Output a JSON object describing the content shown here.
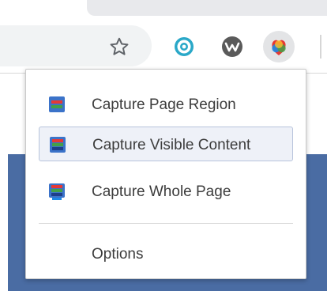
{
  "toolbar": {
    "bookmark_icon": "star-icon",
    "extensions": [
      {
        "name": "extension-clock-icon",
        "color": "#2aa8c8"
      },
      {
        "name": "extension-w-icon",
        "color": "#5a5a5a"
      },
      {
        "name": "extension-screenshot-icon",
        "color": "#e53935"
      }
    ]
  },
  "menu": {
    "items": [
      {
        "label": "Capture Page Region",
        "icon": "capture-region-icon"
      },
      {
        "label": "Capture Visible Content",
        "icon": "capture-visible-icon"
      },
      {
        "label": "Capture Whole Page",
        "icon": "capture-whole-icon"
      }
    ],
    "options_label": "Options"
  },
  "colors": {
    "page_accent": "#4a6ca3",
    "hover_bg": "#eef1f8",
    "hover_border": "#b8c4dc"
  }
}
